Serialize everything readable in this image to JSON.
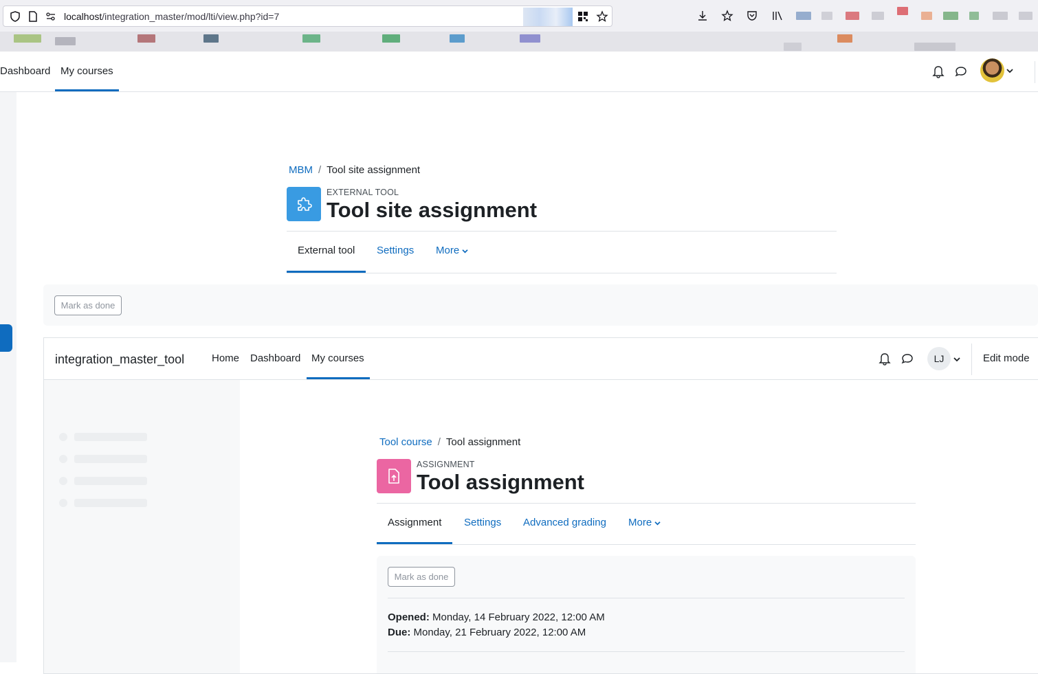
{
  "browser": {
    "url_host": "localhost",
    "url_path": "/integration_master/mod/lti/view.php?id=7"
  },
  "outer_nav": {
    "items": [
      {
        "label": "Dashboard"
      },
      {
        "label": "My courses"
      }
    ]
  },
  "outer_page": {
    "breadcrumb": [
      {
        "label": "MBM"
      },
      {
        "label": "Tool site assignment"
      }
    ],
    "activity_type": "EXTERNAL TOOL",
    "title": "Tool site assignment",
    "tabs": [
      {
        "label": "External tool"
      },
      {
        "label": "Settings"
      },
      {
        "label": "More"
      }
    ],
    "mark_done_label": "Mark as done",
    "colors": {
      "icon_bg": "#399be2",
      "accent": "#0f6cbf"
    }
  },
  "frame": {
    "site_name": "integration_master_tool",
    "nav_items": [
      {
        "label": "Home"
      },
      {
        "label": "Dashboard"
      },
      {
        "label": "My courses"
      }
    ],
    "user_initials": "LJ",
    "edit_mode_label": "Edit mode",
    "breadcrumb": [
      {
        "label": "Tool course"
      },
      {
        "label": "Tool assignment"
      }
    ],
    "activity_type": "ASSIGNMENT",
    "title": "Tool assignment",
    "tabs": [
      {
        "label": "Assignment"
      },
      {
        "label": "Settings"
      },
      {
        "label": "Advanced grading"
      },
      {
        "label": "More"
      }
    ],
    "mark_done_label": "Mark as done",
    "dates": {
      "opened_label": "Opened:",
      "opened_value": "Monday, 14 February 2022, 12:00 AM",
      "due_label": "Due:",
      "due_value": "Monday, 21 February 2022, 12:00 AM"
    },
    "colors": {
      "icon_bg": "#eb66a2"
    }
  }
}
